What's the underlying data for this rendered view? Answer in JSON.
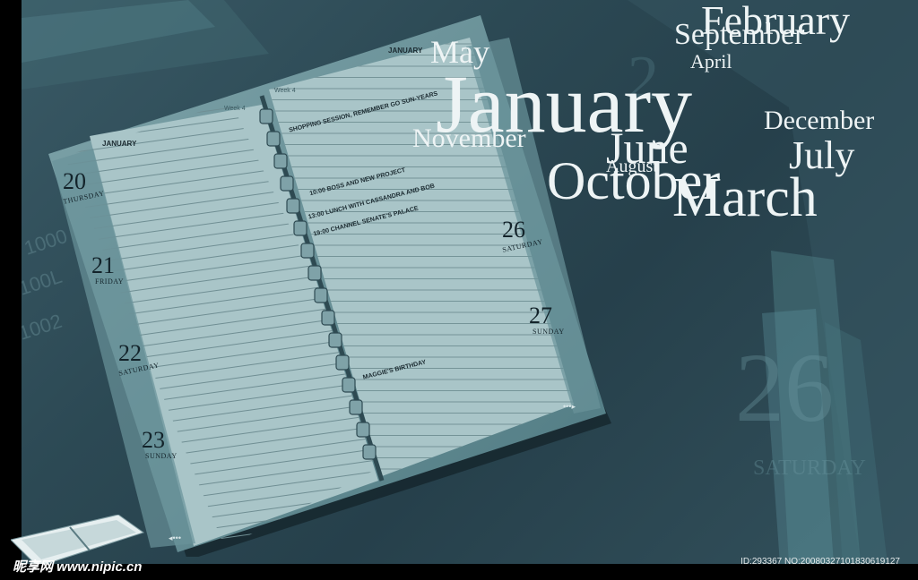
{
  "diary": {
    "left_page_month": "JANUARY",
    "right_page_month": "JANUARY",
    "left_week": "Week 4",
    "right_week": "Week 4",
    "left_days": [
      {
        "num": "20",
        "name": "THURSDAY"
      },
      {
        "num": "21",
        "name": "FRIDAY"
      },
      {
        "num": "22",
        "name": "SATURDAY"
      },
      {
        "num": "23",
        "name": "SUNDAY"
      }
    ],
    "right_days": [
      {
        "num": "26",
        "name": "SATURDAY"
      },
      {
        "num": "27",
        "name": "SUNDAY"
      }
    ],
    "notes": [
      "SHOPPING SESSION, REMEMBER GO SUN-YEARS",
      "10:00 BOSS AND NEW PROJECT",
      "13:00 LUNCH WITH CASSANDRA AND BOB",
      "19:00 CHANNEL SENATE'S PALACE",
      "MAGGIE'S BIRTHDAY"
    ]
  },
  "months": {
    "january": "January",
    "february": "February",
    "september": "September",
    "may": "May",
    "april": "April",
    "november": "November",
    "december": "December",
    "june": "June",
    "july": "July",
    "august": "August",
    "october": "October",
    "march": "March"
  },
  "watermark": {
    "left": "昵享网 www.nipic.cn",
    "right": "ID:293367 NO:20080327101830619127"
  },
  "colors": {
    "background": "#2c4954",
    "page": "#a9c5c8",
    "text": "#eef4f5"
  }
}
